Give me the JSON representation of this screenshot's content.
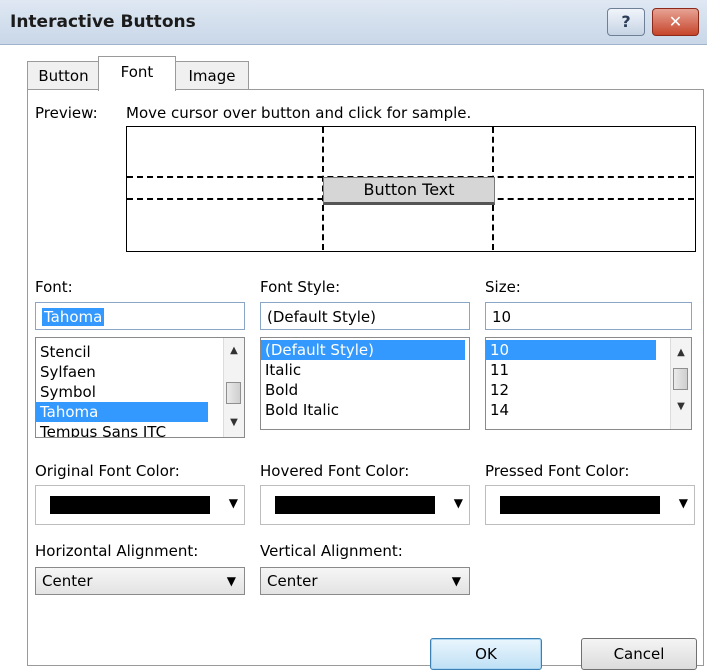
{
  "window": {
    "title": "Interactive Buttons"
  },
  "titlebar": {
    "help_glyph": "?",
    "close_glyph": "✕"
  },
  "tabs": [
    {
      "label": "Button",
      "active": false
    },
    {
      "label": "Font",
      "active": true
    },
    {
      "label": "Image",
      "active": false
    }
  ],
  "preview": {
    "label": "Preview:",
    "instructions": "Move cursor over button and click for sample.",
    "button_text": "Button Text"
  },
  "font": {
    "label": "Font:",
    "value": "Tahoma",
    "items": [
      "Stencil",
      "Sylfaen",
      "Symbol",
      "Tahoma",
      "Tempus Sans ITC"
    ],
    "selected": "Tahoma"
  },
  "font_style": {
    "label": "Font Style:",
    "value": "(Default Style)",
    "items": [
      "(Default Style)",
      "Italic",
      "Bold",
      "Bold Italic"
    ],
    "selected": "(Default Style)"
  },
  "size": {
    "label": "Size:",
    "value": "10",
    "items": [
      "10",
      "11",
      "12",
      "14"
    ],
    "selected": "10"
  },
  "colors": {
    "original_label": "Original Font Color:",
    "hovered_label": "Hovered Font Color:",
    "pressed_label": "Pressed Font Color:",
    "original": "#000000",
    "hovered": "#000000",
    "pressed": "#000000"
  },
  "alignment": {
    "horizontal_label": "Horizontal Alignment:",
    "horizontal_value": "Center",
    "vertical_label": "Vertical Alignment:",
    "vertical_value": "Center"
  },
  "buttons": {
    "ok_label": "OK",
    "cancel_label": "Cancel"
  },
  "icons": {
    "dropdown": "chevron-down-icon",
    "scroll_up": "scroll-up-icon",
    "scroll_down": "scroll-down-icon"
  }
}
